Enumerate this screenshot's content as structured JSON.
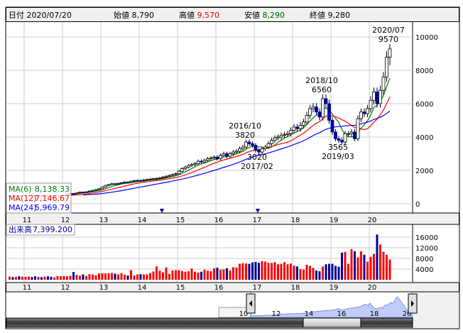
{
  "header": {
    "date_label": "日付",
    "date": "2020/07/20",
    "open_label": "始値",
    "open": "8,790",
    "high_label": "高値",
    "high": "9,570",
    "low_label": "安値",
    "low": "8,290",
    "close_label": "終値",
    "close": "9,280"
  },
  "legend": {
    "ma6_label": "MA(6)",
    "ma6": "8,138.33",
    "ma12_label": "MA(12)",
    "ma12": "7,146.67",
    "ma24_label": "MA(24)",
    "ma24": "5,969.79"
  },
  "volume_box": {
    "label": "出来高",
    "value": "7,399.200"
  },
  "annotations": [
    {
      "line1": "2020/07",
      "line2": "9570"
    },
    {
      "line1": "2018/10",
      "line2": "6560"
    },
    {
      "line1": "2016/10",
      "line2": "3820"
    },
    {
      "line1": "3020",
      "line2": "2017/02"
    },
    {
      "line1": "3565",
      "line2": "2019/03"
    }
  ],
  "navigator": {
    "labels": [
      "10",
      "12",
      "14",
      "16",
      "18",
      "20"
    ]
  },
  "colors": {
    "up_volume": "#ff0000",
    "down_volume": "#000099",
    "down_candle": "#0000a0",
    "ma6": "#008000",
    "ma12": "#ff0000",
    "ma24": "#0000ff",
    "high": "#ff0000",
    "low": "#006600",
    "nav_fill": "#c0cdfa"
  },
  "chart_data": {
    "type": "candlestick",
    "period": "monthly",
    "start": "2010/08",
    "end": "2020/07",
    "x_ticks": [
      "11",
      "12",
      "13",
      "14",
      "15",
      "16",
      "17",
      "18",
      "19",
      "20"
    ],
    "price_axis": {
      "ticks": [
        "10000",
        "8000",
        "6000",
        "4000",
        "2000",
        "0"
      ],
      "ylim": [
        0,
        10000
      ]
    },
    "volume_axis": {
      "ticks": [
        "16000",
        "12000",
        "8000",
        "4000"
      ],
      "ylim": [
        0,
        16000
      ]
    },
    "last_candle": {
      "open": 8790,
      "high": 9570,
      "low": 8290,
      "close": 9280
    },
    "close": [
      480,
      470,
      500,
      490,
      510,
      520,
      540,
      500,
      480,
      490,
      470,
      480,
      460,
      450,
      470,
      480,
      500,
      560,
      600,
      620,
      610,
      650,
      700,
      690,
      720,
      760,
      800,
      850,
      900,
      1000,
      1100,
      1150,
      1200,
      1180,
      1220,
      1250,
      1300,
      1280,
      1350,
      1380,
      1400,
      1380,
      1420,
      1450,
      1480,
      1500,
      1520,
      1550,
      1600,
      1650,
      1700,
      1750,
      1800,
      1950,
      2100,
      2200,
      2300,
      2350,
      2400,
      2550,
      2500,
      2600,
      2700,
      2750,
      2800,
      2700,
      2900,
      3000,
      2850,
      3000,
      3100,
      3150,
      3300,
      3400,
      3700,
      3600,
      3500,
      3200,
      3100,
      3300,
      3400,
      3600,
      3800,
      3950,
      4000,
      4100,
      4150,
      4200,
      4400,
      4600,
      4500,
      4700,
      4900,
      5300,
      5700,
      5800,
      5500,
      5200,
      6300,
      6000,
      5000,
      4300,
      3900,
      3800,
      3700,
      4200,
      4200,
      4300,
      3900,
      5100,
      5500,
      5400,
      5700,
      6200,
      6700,
      6000,
      6800,
      7600,
      8790,
      9280
    ],
    "volume": [
      1200,
      1000,
      1100,
      1300,
      1200,
      1100,
      1200,
      1000,
      1300,
      1100,
      1000,
      1200,
      1300,
      1100,
      900,
      1400,
      1300,
      1400,
      1300,
      1500,
      2900,
      1800,
      1500,
      2000,
      1400,
      2100,
      2000,
      1700,
      2400,
      2400,
      2400,
      2400,
      2500,
      2300,
      2000,
      2400,
      1900,
      1600,
      3600,
      1600,
      2000,
      2100,
      2000,
      2000,
      2500,
      3100,
      5000,
      3400,
      2800,
      4600,
      2200,
      3500,
      3600,
      3600,
      3300,
      3000,
      3200,
      4200,
      3000,
      2700,
      3000,
      3800,
      3400,
      3200,
      4300,
      4500,
      3800,
      3900,
      4300,
      3500,
      4700,
      4600,
      6000,
      6200,
      6100,
      6000,
      6500,
      6700,
      6400,
      7000,
      6800,
      6400,
      6300,
      6600,
      5800,
      6000,
      6600,
      5800,
      6100,
      5300,
      5000,
      4000,
      3800,
      5600,
      5200,
      4400,
      3500,
      3200,
      5000,
      5800,
      6000,
      6000,
      5200,
      4900,
      10200,
      10500,
      6000,
      11500,
      10700,
      8400,
      10700,
      9400,
      6800,
      8600,
      9700,
      17000,
      13200,
      10500,
      9400,
      7600
    ]
  }
}
